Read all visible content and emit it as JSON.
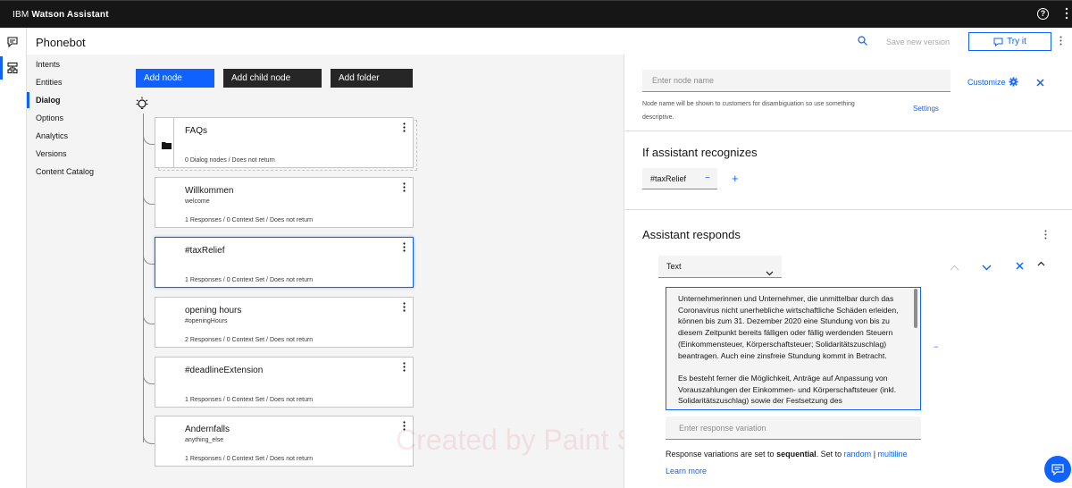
{
  "topbar": {
    "brand_prefix": "IBM",
    "brand_name": "Watson Assistant"
  },
  "header": {
    "title": "Phonebot",
    "save_label": "Save new version",
    "try_label": "Try it"
  },
  "sidenav": {
    "items": [
      {
        "label": "Intents"
      },
      {
        "label": "Entities"
      },
      {
        "label": "Dialog"
      },
      {
        "label": "Options"
      },
      {
        "label": "Analytics"
      },
      {
        "label": "Versions"
      },
      {
        "label": "Content Catalog"
      }
    ]
  },
  "toolbar": {
    "add_node": "Add node",
    "add_child_node": "Add child node",
    "add_folder": "Add folder"
  },
  "nodes": [
    {
      "title": "FAQs",
      "condition": "",
      "meta": "0 Dialog nodes / Does not return"
    },
    {
      "title": "Willkommen",
      "condition": "welcome",
      "meta": "1 Responses / 0 Context Set / Does not return"
    },
    {
      "title": "#taxRelief",
      "condition": "",
      "meta": "1 Responses / 0 Context Set / Does not return"
    },
    {
      "title": "opening hours",
      "condition": "#openingHours",
      "meta": "2 Responses / 0 Context Set / Does not return"
    },
    {
      "title": "#deadlineExtension",
      "condition": "",
      "meta": "1 Responses / 0 Context Set / Does not return"
    },
    {
      "title": "Andernfalls",
      "condition": "anything_else",
      "meta": "1 Responses / 0 Context Set / Does not return"
    }
  ],
  "watermark": "Created by Paint S",
  "panel": {
    "node_name_placeholder": "Enter node name",
    "node_name_hint": "Node name will be shown to customers for disambiguation so use something descriptive.",
    "settings_label": "Settings",
    "customize_label": "Customize",
    "recognizes_title": "If assistant recognizes",
    "intent": "#taxRelief",
    "intent_remove": "−",
    "add_condition": "+",
    "responds_title": "Assistant responds",
    "response_type": "Text",
    "response_text_1": "Unternehmerinnen und Unternehmer, die unmittelbar durch das Coronavirus nicht unerhebliche wirtschaftliche Schäden erleiden, können bis zum 31. Dezember 2020 eine Stundung von bis zu diesem Zeitpunkt bereits fälligen oder fällig werdenden Steuern (Einkommensteuer, Körperschaftsteuer; Solidaritätszuschlag) beantragen. Auch eine zinsfreie Stundung kommt in Betracht.",
    "response_text_2": "Es besteht ferner die Möglichkeit, Anträge auf Anpassung von Vorauszahlungen der Einkommen- und Körperschaftsteuer (inkl. Solidaritätszuschlag) sowie der Festsetzung des",
    "remove_variation": "−",
    "variation_placeholder": "Enter response variation",
    "variation_note_prefix": "Response variations are set to",
    "variation_mode": "sequential",
    "variation_note_mid": ". Set to",
    "variation_random": "random",
    "variation_sep": "|",
    "variation_multiline": "multiline",
    "learn_more": "Learn more"
  },
  "colors": {
    "accent": "#0f62fe",
    "topbar": "#161616",
    "dark_button": "#262626"
  }
}
